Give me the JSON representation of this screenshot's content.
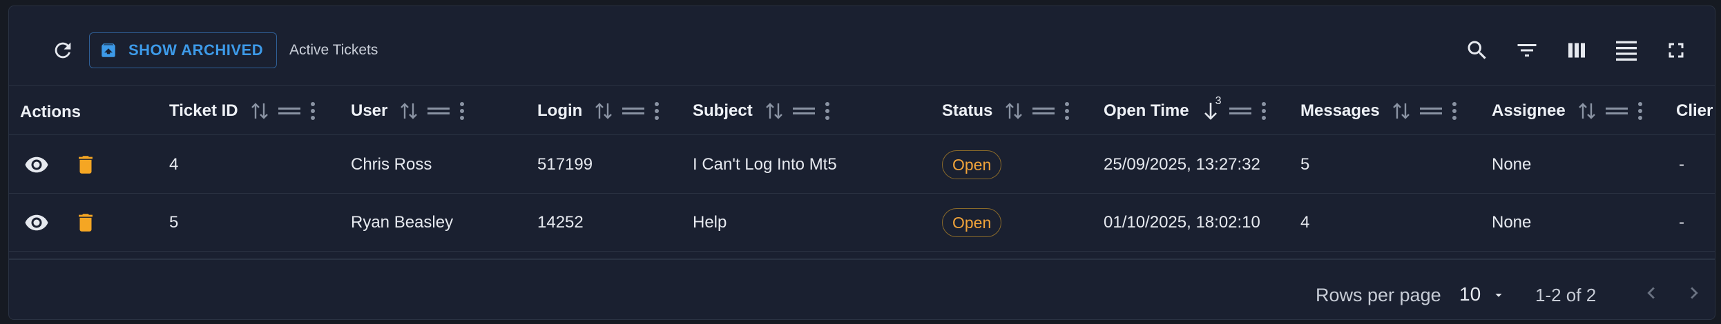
{
  "toolbar": {
    "show_archived_label": "SHOW ARCHIVED",
    "caption": "Active Tickets"
  },
  "table": {
    "columns": [
      {
        "key": "actions",
        "label": "Actions"
      },
      {
        "key": "ticket_id",
        "label": "Ticket ID"
      },
      {
        "key": "user",
        "label": "User"
      },
      {
        "key": "login",
        "label": "Login"
      },
      {
        "key": "subject",
        "label": "Subject"
      },
      {
        "key": "status",
        "label": "Status"
      },
      {
        "key": "open_time",
        "label": "Open Time",
        "sort": "desc",
        "sort_index": "3"
      },
      {
        "key": "messages",
        "label": "Messages"
      },
      {
        "key": "assignee",
        "label": "Assignee"
      },
      {
        "key": "client",
        "label": "Clier"
      }
    ],
    "rows": [
      {
        "ticket_id": "4",
        "user": "Chris Ross",
        "login": "517199",
        "subject": "I Can't Log Into Mt5",
        "status": "Open",
        "open_time": "25/09/2025, 13:27:32",
        "messages": "5",
        "assignee": "None",
        "client": "-"
      },
      {
        "ticket_id": "5",
        "user": "Ryan Beasley",
        "login": "14252",
        "subject": "Help",
        "status": "Open",
        "open_time": "01/10/2025, 18:02:10",
        "messages": "4",
        "assignee": "None",
        "client": "-"
      }
    ]
  },
  "pagination": {
    "rows_per_page_label": "Rows per page",
    "rows_per_page_value": "10",
    "range_text": "1-2 of 2"
  },
  "colors": {
    "background": "#1a2030",
    "accent": "#3d9ae8",
    "status_open": "#f0a33a",
    "delete_icon": "#f5a623"
  },
  "icons": [
    "refresh-icon",
    "archive-icon",
    "search-icon",
    "filter-icon",
    "columns-icon",
    "density-icon",
    "fullscreen-icon",
    "sort-icon",
    "drag-handle-icon",
    "column-menu-icon",
    "view-icon",
    "delete-icon",
    "caret-down-icon",
    "chevron-left-icon",
    "chevron-right-icon"
  ]
}
